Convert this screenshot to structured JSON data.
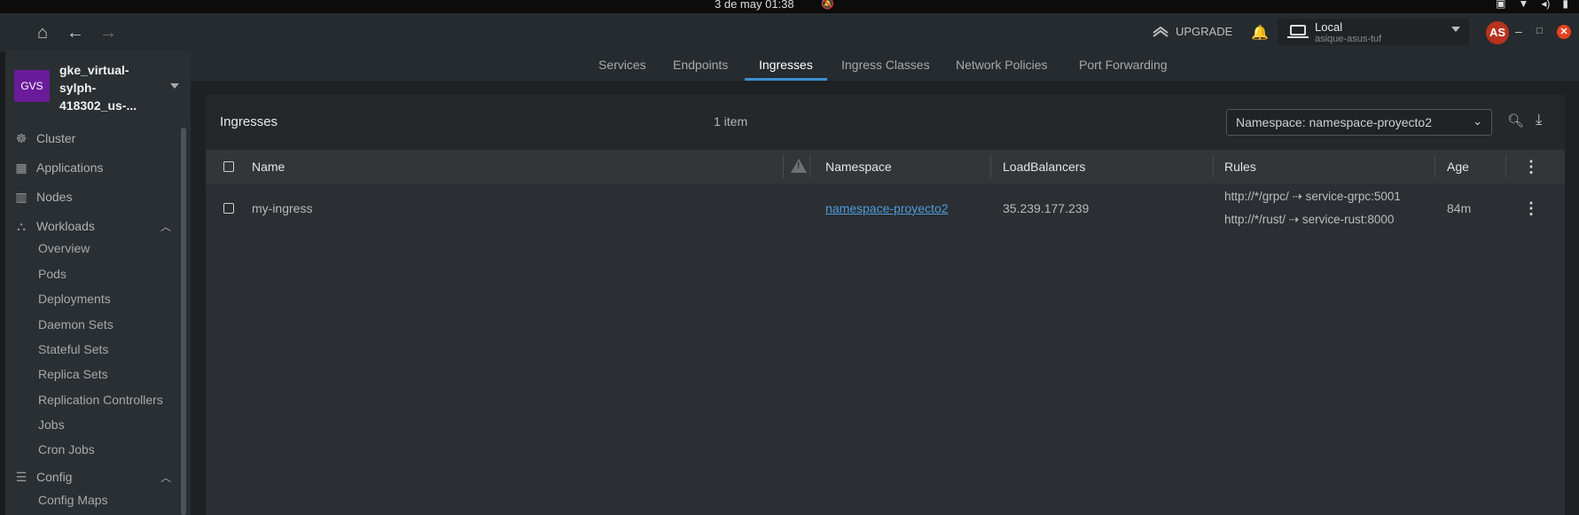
{
  "os_bar": {
    "clock": "3 de may  01:38"
  },
  "top_bar": {
    "upgrade_label": "UPGRADE",
    "cluster_select": {
      "name": "Local",
      "host": "asique-asus-tuf"
    },
    "avatar_initials": "AS"
  },
  "sidebar": {
    "cluster": {
      "badge": "GVS",
      "name": "gke_virtual-sylph-418302_us-..."
    },
    "items": [
      {
        "label": "Cluster",
        "icon": "helm-icon"
      },
      {
        "label": "Applications",
        "icon": "grid-icon"
      },
      {
        "label": "Nodes",
        "icon": "nodes-icon"
      },
      {
        "label": "Workloads",
        "icon": "workloads-icon",
        "expanded": true
      },
      {
        "label": "Config",
        "icon": "list-icon",
        "expanded": true
      }
    ],
    "workloads_children": [
      "Overview",
      "Pods",
      "Deployments",
      "Daemon Sets",
      "Stateful Sets",
      "Replica Sets",
      "Replication Controllers",
      "Jobs",
      "Cron Jobs"
    ],
    "config_children": [
      "Config Maps"
    ]
  },
  "tabs": [
    {
      "label": "Services",
      "active": false
    },
    {
      "label": "Endpoints",
      "active": false
    },
    {
      "label": "Ingresses",
      "active": true
    },
    {
      "label": "Ingress Classes",
      "active": false
    },
    {
      "label": "Network Policies",
      "active": false
    },
    {
      "label": "Port Forwarding",
      "active": false
    }
  ],
  "list": {
    "title": "Ingresses",
    "count": "1 item",
    "namespace_filter": "Namespace: namespace-proyecto2",
    "columns": [
      "Name",
      "Namespace",
      "LoadBalancers",
      "Rules",
      "Age"
    ],
    "rows": [
      {
        "name": "my-ingress",
        "namespace": "namespace-proyecto2",
        "load_balancers": "35.239.177.239",
        "rules": [
          "http://*/grpc/ ⇢ service-grpc:5001",
          "http://*/rust/ ⇢ service-rust:8000"
        ],
        "age": "84m"
      }
    ]
  },
  "colors": {
    "accent": "#3d90ce",
    "link": "#4e9bdd",
    "cluster_badge": "#6a1b9a",
    "avatar": "#b8331d",
    "close": "#e2421d"
  }
}
